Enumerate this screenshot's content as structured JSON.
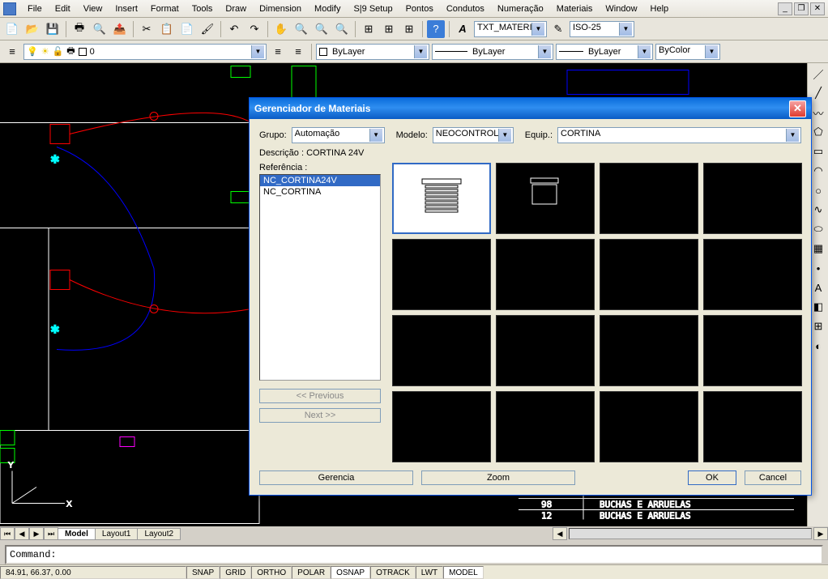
{
  "menu": [
    "File",
    "Edit",
    "View",
    "Insert",
    "Format",
    "Tools",
    "Draw",
    "Dimension",
    "Modify",
    "S|9 Setup",
    "Pontos",
    "Condutos",
    "Numeração",
    "Materiais",
    "Window",
    "Help"
  ],
  "toolbar2": {
    "text_style": "TXT_MATERIA",
    "dim_style": "ISO-25"
  },
  "toolbar3": {
    "layer": "0",
    "bylayer1": "ByLayer",
    "bylayer2": "ByLayer",
    "bylayer3": "ByLayer",
    "bycolor": "ByColor"
  },
  "tabs": {
    "model": "Model",
    "layout1": "Layout1",
    "layout2": "Layout2"
  },
  "cmd": {
    "prompt": "Command:"
  },
  "status": {
    "coords": "84.91, 66.37, 0.00",
    "snap": "SNAP",
    "grid": "GRID",
    "ortho": "ORTHO",
    "polar": "POLAR",
    "osnap": "OSNAP",
    "otrack": "OTRACK",
    "lwt": "LWT",
    "model": "MODEL"
  },
  "sched": {
    "row1_num": "98",
    "row1_txt": "BUCHAS E ARRUELAS",
    "row2_num": "12",
    "row2_txt": "BUCHAS E ARRUELAS"
  },
  "dialog": {
    "title": "Gerenciador de Materiais",
    "grupo_label": "Grupo:",
    "grupo_value": "Automação",
    "modelo_label": "Modelo:",
    "modelo_value": "NEOCONTROL",
    "equip_label": "Equip.:",
    "equip_value": "CORTINA",
    "descricao": "Descrição : CORTINA 24V",
    "referencia_label": "Referência :",
    "ref_items": [
      "NC_CORTINA24V",
      "NC_CORTINA"
    ],
    "btn_prev": "<< Previous",
    "btn_next": "Next >>",
    "btn_gerencia": "Gerencia",
    "btn_zoom": "Zoom",
    "btn_ok": "OK",
    "btn_cancel": "Cancel"
  }
}
